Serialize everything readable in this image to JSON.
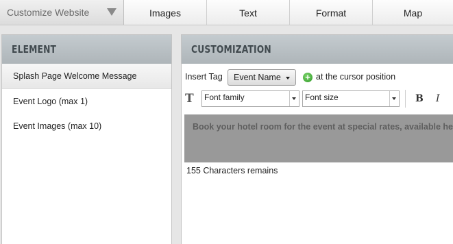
{
  "topbar": {
    "dropdown_label": "Customize Website",
    "tabs": [
      {
        "label": "Images"
      },
      {
        "label": "Text"
      },
      {
        "label": "Format"
      },
      {
        "label": "Map"
      }
    ]
  },
  "left_panel": {
    "header": "ELEMENT",
    "items": [
      {
        "label": "Splash Page Welcome Message",
        "selected": true
      },
      {
        "label": "Event Logo (max 1)",
        "selected": false
      },
      {
        "label": "Event Images (max 10)",
        "selected": false
      }
    ]
  },
  "right_panel": {
    "header": "CUSTOMIZATION",
    "insert_tag_label": "Insert Tag",
    "tag_select_value": "Event Name",
    "cursor_text": "at the cursor position",
    "font_family_placeholder": "Font family",
    "font_size_placeholder": "Font size",
    "bold_label": "B",
    "italic_label": "I",
    "editor_text": "Book your hotel room for the event at special rates, available here",
    "char_count_text": "155 Characters remains"
  },
  "icons": {
    "text_format": "text-format-icon",
    "add_tag": "plus-circle-icon",
    "dropdown_arrow": "triangle-down-icon"
  },
  "colors": {
    "panel_header_bg": "#b8bfc3",
    "panel_header_text": "#414a4f",
    "editor_bg": "#999999",
    "add_icon_green": "#2f9a28"
  }
}
